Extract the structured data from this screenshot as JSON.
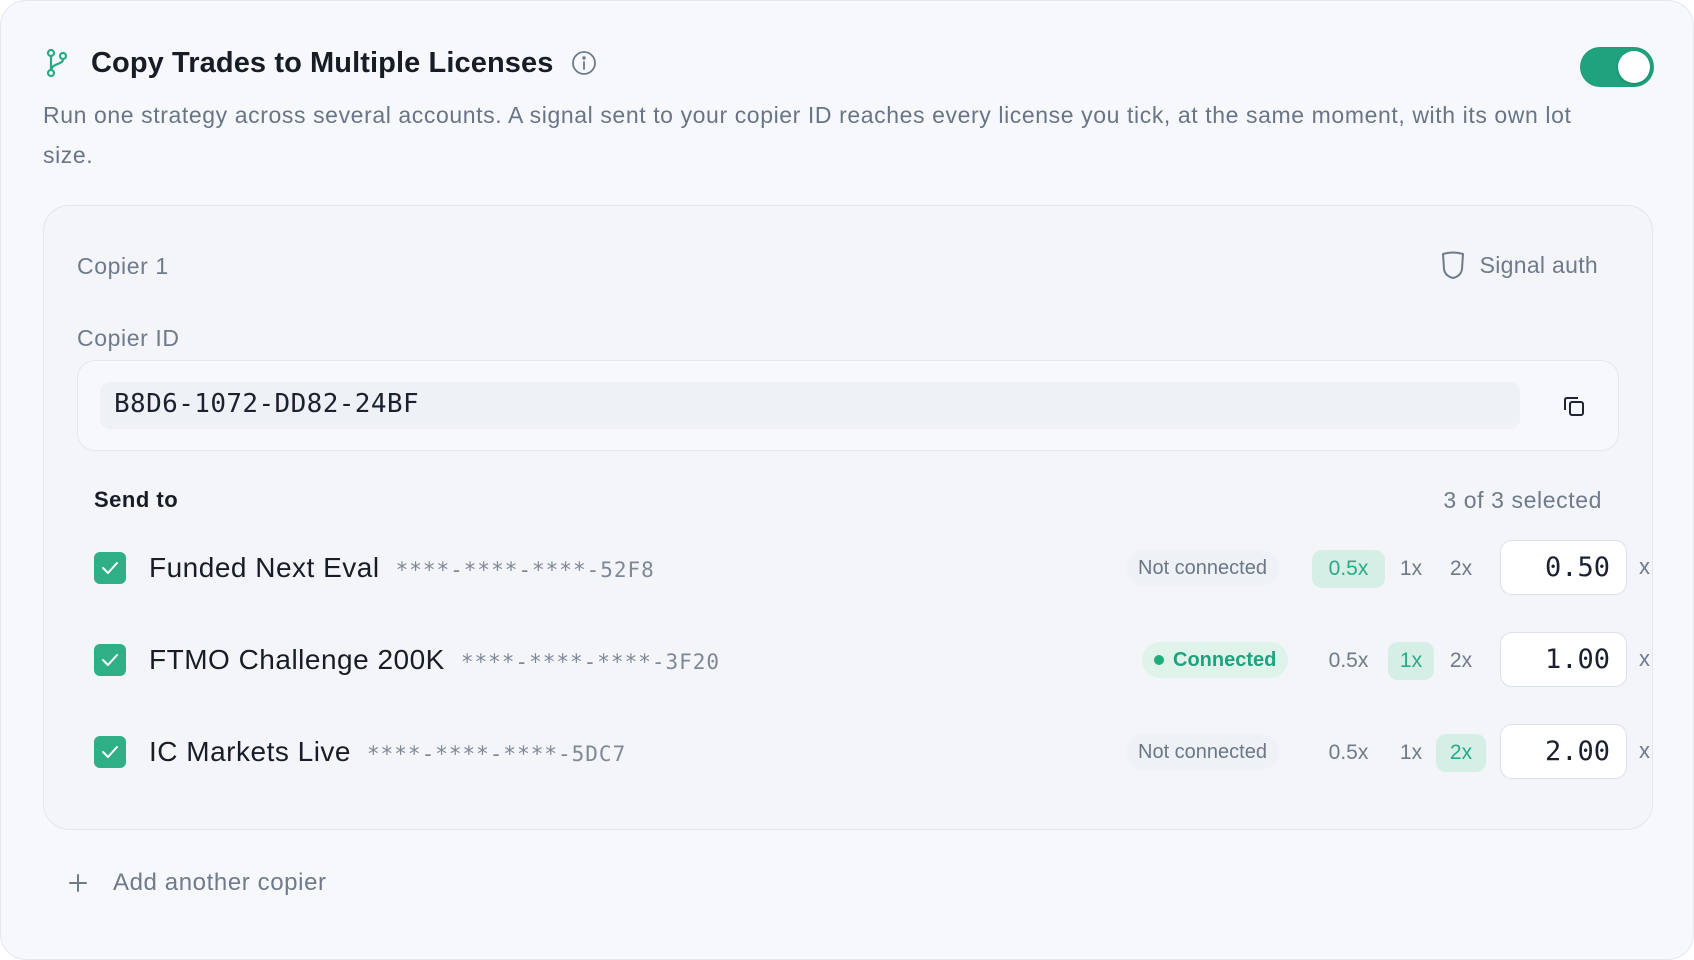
{
  "header": {
    "title": "Copy Trades to Multiple Licenses",
    "icon": "git-branch-icon",
    "info_icon": "info-icon",
    "enabled": true,
    "accent_color": "#1fa37f"
  },
  "description": "Run one strategy across several accounts. A signal sent to your copier ID reaches every license you tick, at the same moment, with its own lot size.",
  "copier": {
    "name": "Copier 1",
    "signal_auth_label": "Signal auth",
    "copier_id_label": "Copier ID",
    "copier_id_value": "B8D6-1072-DD82-24BF",
    "send_to_label": "Send to",
    "selected_count": "3 of 3 selected",
    "multiplier_options": [
      "0.5x",
      "1x",
      "2x"
    ],
    "suffix": "x",
    "licenses": [
      {
        "name": "Funded Next Eval",
        "key": "****-****-****-52F8",
        "status": "Not connected",
        "connected": false,
        "checked": true,
        "active_multiplier": "0.5x",
        "value": "0.50"
      },
      {
        "name": "FTMO Challenge 200K",
        "key": "****-****-****-3F20",
        "status": "Connected",
        "connected": true,
        "checked": true,
        "active_multiplier": "1x",
        "value": "1.00"
      },
      {
        "name": "IC Markets Live",
        "key": "****-****-****-5DC7",
        "status": "Not connected",
        "connected": false,
        "checked": true,
        "active_multiplier": "2x",
        "value": "2.00"
      }
    ]
  },
  "add_copier_label": "Add another copier"
}
